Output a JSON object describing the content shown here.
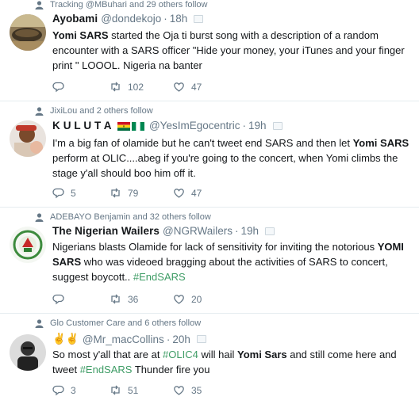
{
  "tweets": [
    {
      "social_context": "Tracking @MBuhari and 29 others follow",
      "name": "Ayobami",
      "handle": "@dondekojo",
      "separator": "·",
      "time": "18h",
      "text_segments": [
        {
          "t": "Yomi SARS",
          "bold": true
        },
        {
          "t": " started the Oja ti burst song with a description of a random encounter with a SARS officer \"Hide your money, your iTunes and your finger print \" LOOOL. Nigeria na banter"
        }
      ],
      "reply_count": "",
      "retweet_count": "102",
      "like_count": "47"
    },
    {
      "social_context": "JixiLou and 2 others follow",
      "name": "K U L U T A",
      "handle": "@YesImEgocentric",
      "separator": "·",
      "time": "19h",
      "text_segments": [
        {
          "t": "I'm a big fan of olamide but he can't tweet end SARS and then let "
        },
        {
          "t": "Yomi SARS",
          "bold": true
        },
        {
          "t": " perform at OLIC....abeg if you're going to the concert, when Yomi climbs the stage y'all should boo him off it."
        }
      ],
      "reply_count": "5",
      "retweet_count": "79",
      "like_count": "47"
    },
    {
      "social_context": "ADEBAYO Benjamin and 32 others follow",
      "name": "The Nigerian Wailers",
      "handle": "@NGRWailers",
      "separator": "·",
      "time": "19h",
      "text_segments": [
        {
          "t": "Nigerians blasts Olamide for lack of sensitivity for inviting the notorious "
        },
        {
          "t": "YOMI SARS",
          "bold": true
        },
        {
          "t": " who was videoed bragging about the activities of SARS to concert, suggest boycott.. "
        },
        {
          "t": "#EndSARS",
          "hashtag": true
        }
      ],
      "reply_count": "",
      "retweet_count": "36",
      "like_count": "20"
    },
    {
      "social_context": "Glo Customer Care and 6 others follow",
      "name": "✌✌",
      "handle": "@Mr_macCollins",
      "separator": "·",
      "time": "20h",
      "text_segments": [
        {
          "t": "So most y'all that are at "
        },
        {
          "t": "#OLIC4",
          "hashtag": true
        },
        {
          "t": " will hail "
        },
        {
          "t": "Yomi Sars",
          "bold": true
        },
        {
          "t": " and still come here and tweet "
        },
        {
          "t": "#EndSARS",
          "hashtag": true
        },
        {
          "t": " Thunder fire you"
        }
      ],
      "reply_count": "3",
      "retweet_count": "51",
      "like_count": "35"
    }
  ],
  "icons": {
    "social": "person-icon",
    "reply": "reply-icon",
    "retweet": "retweet-icon",
    "like": "heart-icon",
    "caret": "caret-icon"
  },
  "colors": {
    "text": "#14171a",
    "muted": "#657786",
    "hashtag": "#3e9c65",
    "divider": "#e6ecf0"
  }
}
